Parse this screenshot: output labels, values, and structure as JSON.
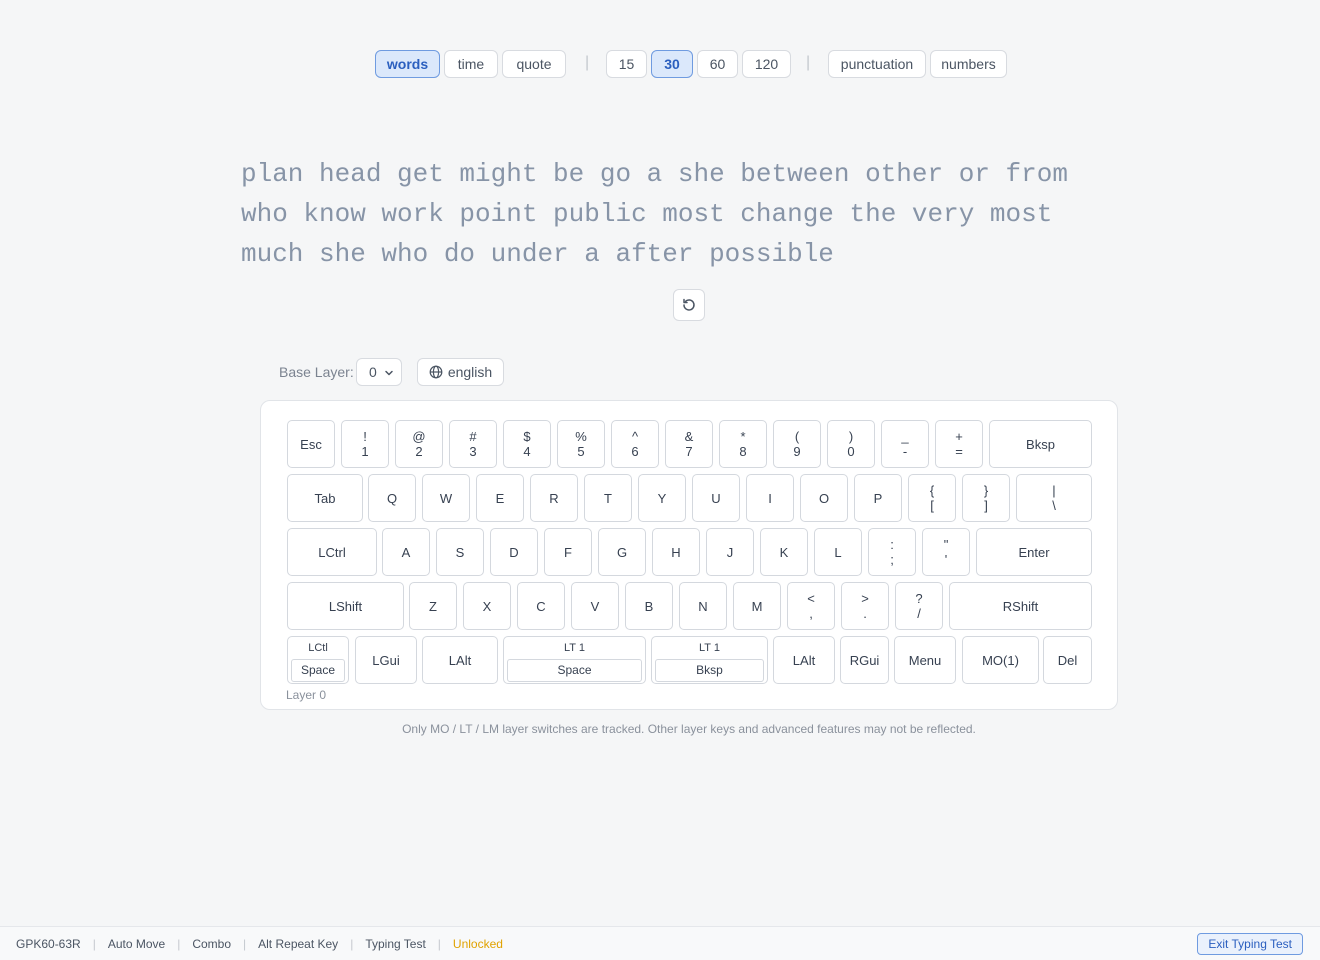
{
  "modes": {
    "type": [
      {
        "label": "words",
        "active": true
      },
      {
        "label": "time",
        "active": false
      },
      {
        "label": "quote",
        "active": false
      }
    ],
    "counts": [
      {
        "label": "15",
        "active": false
      },
      {
        "label": "30",
        "active": true
      },
      {
        "label": "60",
        "active": false
      },
      {
        "label": "120",
        "active": false
      }
    ],
    "extras": [
      {
        "label": "punctuation",
        "active": false
      },
      {
        "label": "numbers",
        "active": false
      }
    ],
    "separator": "|"
  },
  "test": {
    "words": "plan head get might be go a she between other or from who know work point public most change the very most much she who do under a after possible"
  },
  "controls": {
    "base_layer_label": "Base Layer:",
    "base_layer_value": "0",
    "language": "english"
  },
  "keyboard": {
    "layer_caption": "Layer 0",
    "rows": [
      [
        {
          "label": "Esc"
        },
        {
          "top": "!",
          "bottom": "1"
        },
        {
          "top": "@",
          "bottom": "2"
        },
        {
          "top": "#",
          "bottom": "3"
        },
        {
          "top": "$",
          "bottom": "4"
        },
        {
          "top": "%",
          "bottom": "5"
        },
        {
          "top": "^",
          "bottom": "6"
        },
        {
          "top": "&",
          "bottom": "7"
        },
        {
          "top": "*",
          "bottom": "8"
        },
        {
          "top": "(",
          "bottom": "9"
        },
        {
          "top": ")",
          "bottom": "0"
        },
        {
          "top": "_",
          "bottom": "-"
        },
        {
          "top": "+",
          "bottom": "="
        },
        {
          "label": "Bksp"
        }
      ],
      [
        {
          "label": "Tab"
        },
        {
          "label": "Q"
        },
        {
          "label": "W"
        },
        {
          "label": "E"
        },
        {
          "label": "R"
        },
        {
          "label": "T"
        },
        {
          "label": "Y"
        },
        {
          "label": "U"
        },
        {
          "label": "I"
        },
        {
          "label": "O"
        },
        {
          "label": "P"
        },
        {
          "top": "{",
          "bottom": "["
        },
        {
          "top": "}",
          "bottom": "]"
        },
        {
          "top": "|",
          "bottom": "\\"
        }
      ],
      [
        {
          "label": "LCtrl"
        },
        {
          "label": "A"
        },
        {
          "label": "S"
        },
        {
          "label": "D"
        },
        {
          "label": "F"
        },
        {
          "label": "G"
        },
        {
          "label": "H"
        },
        {
          "label": "J"
        },
        {
          "label": "K"
        },
        {
          "label": "L"
        },
        {
          "top": ":",
          "bottom": ";"
        },
        {
          "top": "\"",
          "bottom": "'"
        },
        {
          "label": "Enter"
        }
      ],
      [
        {
          "label": "LShift"
        },
        {
          "label": "Z"
        },
        {
          "label": "X"
        },
        {
          "label": "C"
        },
        {
          "label": "V"
        },
        {
          "label": "B"
        },
        {
          "label": "N"
        },
        {
          "label": "M"
        },
        {
          "top": "<",
          "bottom": ","
        },
        {
          "top": ">",
          "bottom": "."
        },
        {
          "top": "?",
          "bottom": "/"
        },
        {
          "label": "RShift"
        }
      ],
      [
        {
          "hold": "LCtl",
          "tap": "Space"
        },
        {
          "label": "LGui"
        },
        {
          "label": "LAlt"
        },
        {
          "hold": "LT 1",
          "tap": "Space"
        },
        {
          "hold": "LT 1",
          "tap": "Bksp"
        },
        {
          "label": "LAlt"
        },
        {
          "label": "RGui"
        },
        {
          "label": "Menu"
        },
        {
          "label": "MO(1)"
        },
        {
          "label": "Del"
        }
      ]
    ]
  },
  "note": "Only MO / LT / LM layer switches are tracked. Other layer keys and advanced features may not be reflected.",
  "statusbar": {
    "items": [
      "GPK60-63R",
      "Auto Move",
      "Combo",
      "Alt Repeat Key",
      "Typing Test"
    ],
    "lock_status": "Unlocked",
    "lock_color": "#e0a200",
    "exit_label": "Exit Typing Test"
  },
  "colors": {
    "accent": "#2b5fbf",
    "accent_bg": "#dbe8fb"
  },
  "icons": {
    "restart": "restart-icon",
    "language": "globe-icon",
    "select": "chevron-down-icon"
  }
}
